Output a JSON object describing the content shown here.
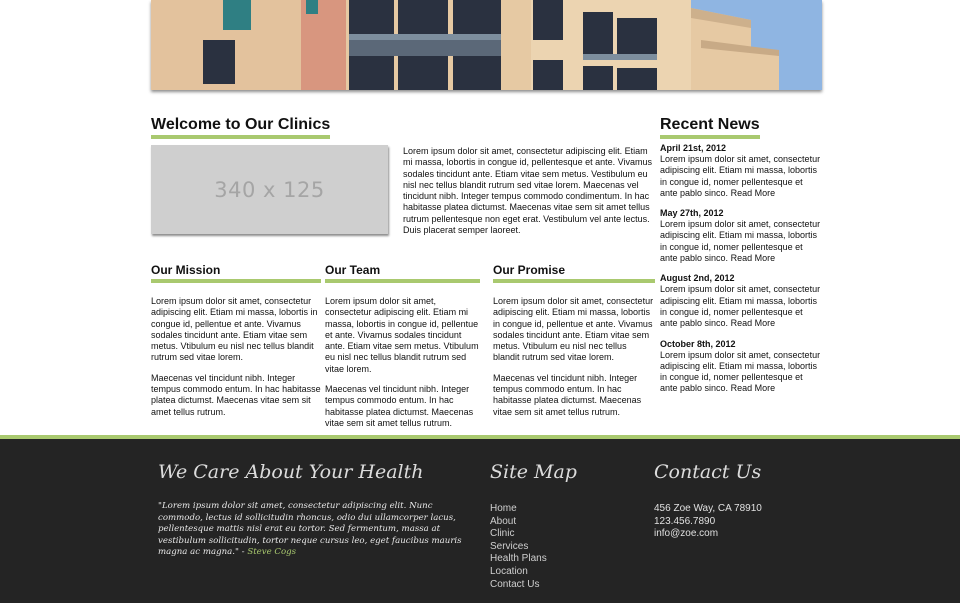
{
  "welcome": {
    "title": "Welcome to Our Clinics",
    "placeholder": "340 x 125",
    "intro": "Lorem ipsum dolor sit amet, consectetur adipiscing elit. Etiam mi massa, lobortis in congue id, pellentesque et ante. Vivamus sodales tincidunt ante. Etiam vitae sem metus. Vestibulum eu nisl nec tellus blandit rutrum sed vitae lorem. Maecenas vel tincidunt nibh. Integer tempus commodo condimentum. In hac habitasse platea dictumst. Maecenas vitae sem sit amet tellus rutrum pellentesque non eget erat. Vestibulum vel ante lectus. Duis placerat semper laoreet."
  },
  "columns": [
    {
      "title": "Our Mission",
      "p1": "Lorem ipsum dolor sit amet, consectetur adipiscing elit. Etiam mi massa, lobortis in congue id, pellentue et ante. Vivamus sodales tincidunt ante. Etiam vitae sem metus. Vtibulum eu nisl nec tellus blandit rutrum sed vitae lorem.",
      "p2": "Maecenas vel tincidunt nibh. Integer tempus commodo entum. In hac habitasse platea dictumst. Maecenas vitae sem sit amet tellus rutrum."
    },
    {
      "title": "Our Team",
      "p1": "Lorem ipsum dolor sit amet, consectetur adipiscing elit. Etiam mi massa, lobortis in congue id, pellentue et ante. Vivamus sodales tincidunt ante. Etiam vitae sem metus. Vtibulum eu nisl nec tellus blandit rutrum sed vitae lorem.",
      "p2": "Maecenas vel tincidunt nibh. Integer tempus commodo entum. In hac habitasse platea dictumst. Maecenas vitae sem sit amet tellus rutrum."
    },
    {
      "title": "Our Promise",
      "p1": "Lorem ipsum dolor sit amet, consectetur adipiscing elit. Etiam mi massa, lobortis in congue id, pellentue et ante. Vivamus sodales tincidunt ante. Etiam vitae sem metus. Vtibulum eu nisl nec tellus blandit rutrum sed vitae lorem.",
      "p2": "Maecenas vel tincidunt nibh. Integer tempus commodo entum. In hac habitasse platea dictumst. Maecenas vitae sem sit amet tellus rutrum."
    }
  ],
  "news": {
    "title": "Recent News",
    "read_more": "Read More",
    "items": [
      {
        "date": "April 21st, 2012",
        "text": "Lorem ipsum dolor sit amet, consectetur adipiscing elit. Etiam mi massa, lobortis in congue id, nomer pellentesque et ante pablo sinco."
      },
      {
        "date": "May 27th, 2012",
        "text": "Lorem ipsum dolor sit amet, consectetur adipiscing elit. Etiam mi massa, lobortis in congue id, nomer pellentesque et ante pablo sinco."
      },
      {
        "date": "August 2nd, 2012",
        "text": "Lorem ipsum dolor sit amet, consectetur adipiscing elit. Etiam mi massa, lobortis in congue id, nomer pellentesque et ante pablo sinco."
      },
      {
        "date": "October 8th, 2012",
        "text": "Lorem ipsum dolor sit amet, consectetur adipiscing elit. Etiam mi massa, lobortis in congue id, nomer pellentesque et ante pablo sinco."
      }
    ]
  },
  "footer": {
    "care_title": "We Care About Your Health",
    "quote": "\"Lorem ipsum dolor sit amet, consectetur adipiscing elit. Nunc commodo, lectus id sollicitudin rhoncus, odio dui ullamcorper lacus, pellentesque mattis nisl erat eu tortor. Sed fermentum, massa at vestibulum sollicitudin, tortor neque cursus leo, eget faucibus mauris magna ac magna.\" -",
    "quote_author": "Steve Cogs",
    "sitemap_title": "Site Map",
    "sitemap": [
      "Home",
      "About",
      "Clinic",
      "Services",
      "Health Plans",
      "Location",
      "Contact Us"
    ],
    "contact_title": "Contact Us",
    "address": "456 Zoe Way, CA 78910",
    "phone": "123.456.7890",
    "email": "info@zoe.com"
  },
  "colors": {
    "accent": "#a9c96f",
    "footer_bg": "#242424"
  }
}
